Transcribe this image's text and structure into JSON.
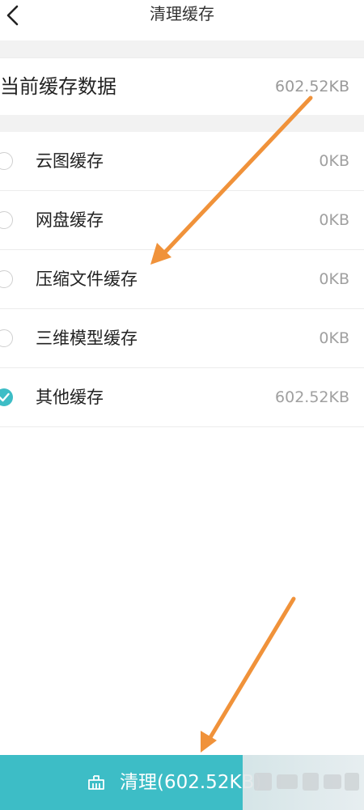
{
  "header": {
    "title": "清理缓存"
  },
  "summary": {
    "label": "当前缓存数据",
    "value": "602.52KB"
  },
  "cache_items": [
    {
      "label": "云图缓存",
      "size": "0KB",
      "checked": false
    },
    {
      "label": "网盘缓存",
      "size": "0KB",
      "checked": false
    },
    {
      "label": "压缩文件缓存",
      "size": "0KB",
      "checked": false
    },
    {
      "label": "三维模型缓存",
      "size": "0KB",
      "checked": false
    },
    {
      "label": "其他缓存",
      "size": "602.52KB",
      "checked": true
    }
  ],
  "clean_button": {
    "label": "清理(602.52KB)",
    "icon": "broom-icon"
  },
  "colors": {
    "accent": "#3dbdc6",
    "annotation_arrow": "#f0923a",
    "secondary_text": "#9a9a9a"
  }
}
